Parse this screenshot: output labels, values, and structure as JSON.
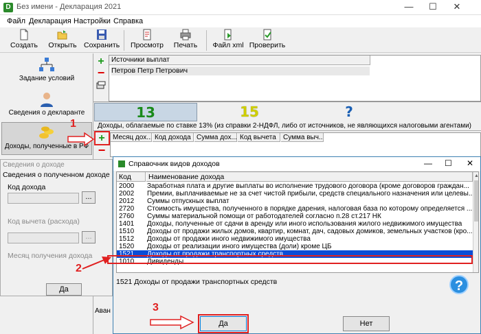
{
  "window": {
    "title": "Без имени - Декларация 2021",
    "app_icon": "D",
    "minimize_glyph": "—",
    "maximize_glyph": "☐",
    "close_glyph": "✕"
  },
  "menu": [
    "Файл",
    "Декларация",
    "Настройки",
    "Справка"
  ],
  "toolbar": {
    "create": "Создать",
    "open": "Открыть",
    "save": "Сохранить",
    "preview": "Просмотр",
    "print": "Печать",
    "xml": "Файл xml",
    "check": "Проверить"
  },
  "sidebar": {
    "items": [
      {
        "label": "Задание условий",
        "icon": "network-icon"
      },
      {
        "label": "Сведения о декларанте",
        "icon": "person-icon"
      },
      {
        "label": "Доходы, полученные в РФ",
        "icon": "coins-icon"
      }
    ],
    "bottom_fragment": "Аван"
  },
  "sources": {
    "header": "Источники выплат",
    "row": "Петров Петр Петрович",
    "plus": "+",
    "minus": "−"
  },
  "rate_tabs": [
    "13",
    "15",
    "?"
  ],
  "income_caption": "Доходы, облагаемые по ставке 13% (из справки 2-НДФЛ, либо от источников, не являющихся налоговыми агентами)",
  "income_columns": [
    "Месяц дох...",
    "Код дохода",
    "Сумма дох...",
    "Код вычета",
    "Сумма выч..."
  ],
  "annotations": [
    "1",
    "2",
    "3"
  ],
  "income_dialog": {
    "title": "Сведения о доходе",
    "group": "Сведения о полученном доходе",
    "income_code_label": "Код дохода",
    "deduction_code_label": "Код вычета (расхода)",
    "month_label": "Месяц получения дохода",
    "browse": "...",
    "ok": "Да"
  },
  "ref_dialog": {
    "title": "Справочник видов доходов",
    "col_code": "Код",
    "col_name": "Наименование дохода",
    "rows": [
      {
        "code": "2000",
        "name": "Заработная плата и другие выплаты во исполнение трудового договора (кроме договоров граждан..."
      },
      {
        "code": "2002",
        "name": "Премии, выплачиваемые не за счет чистой прибыли, средств специального назначения или целевы..."
      },
      {
        "code": "2012",
        "name": "Суммы отпускных выплат"
      },
      {
        "code": "2720",
        "name": "Стоимость имущества, полученного в порядке дарения, налоговая база по которому определяется ..."
      },
      {
        "code": "2760",
        "name": "Суммы материальной помощи от работодателей согласно п.28 ст.217 НК"
      },
      {
        "code": "1401",
        "name": "Доходы, полученные от сдачи в аренду или иного использования жилого недвижимого имущества"
      },
      {
        "code": "1510",
        "name": "Доходы от продажи жилых домов, квартир, комнат, дач, садовых домиков, земельных участков (кро..."
      },
      {
        "code": "1512",
        "name": "Доходы от продажи иного недвижимого имущества"
      },
      {
        "code": "1520",
        "name": "Доходы от реализации иного имущества (доли) кроме ЦБ"
      },
      {
        "code": "1521",
        "name": "Доходы от продажи транспортных средств"
      },
      {
        "code": "1010",
        "name": "Дивиденды"
      }
    ],
    "selected_index": 9,
    "selected_text": "1521  Доходы от продажи транспортных средств",
    "ok": "Да",
    "cancel": "Нет",
    "help": "?",
    "minimize_glyph": "—",
    "maximize_glyph": "☐",
    "close_glyph": "✕"
  },
  "colors": {
    "accent_red": "#e02020",
    "selection_blue": "#0a4cd6",
    "tab_13": "#1a8a1a",
    "tab_15": "#cfcf00",
    "tab_q": "#1a5fb4"
  }
}
